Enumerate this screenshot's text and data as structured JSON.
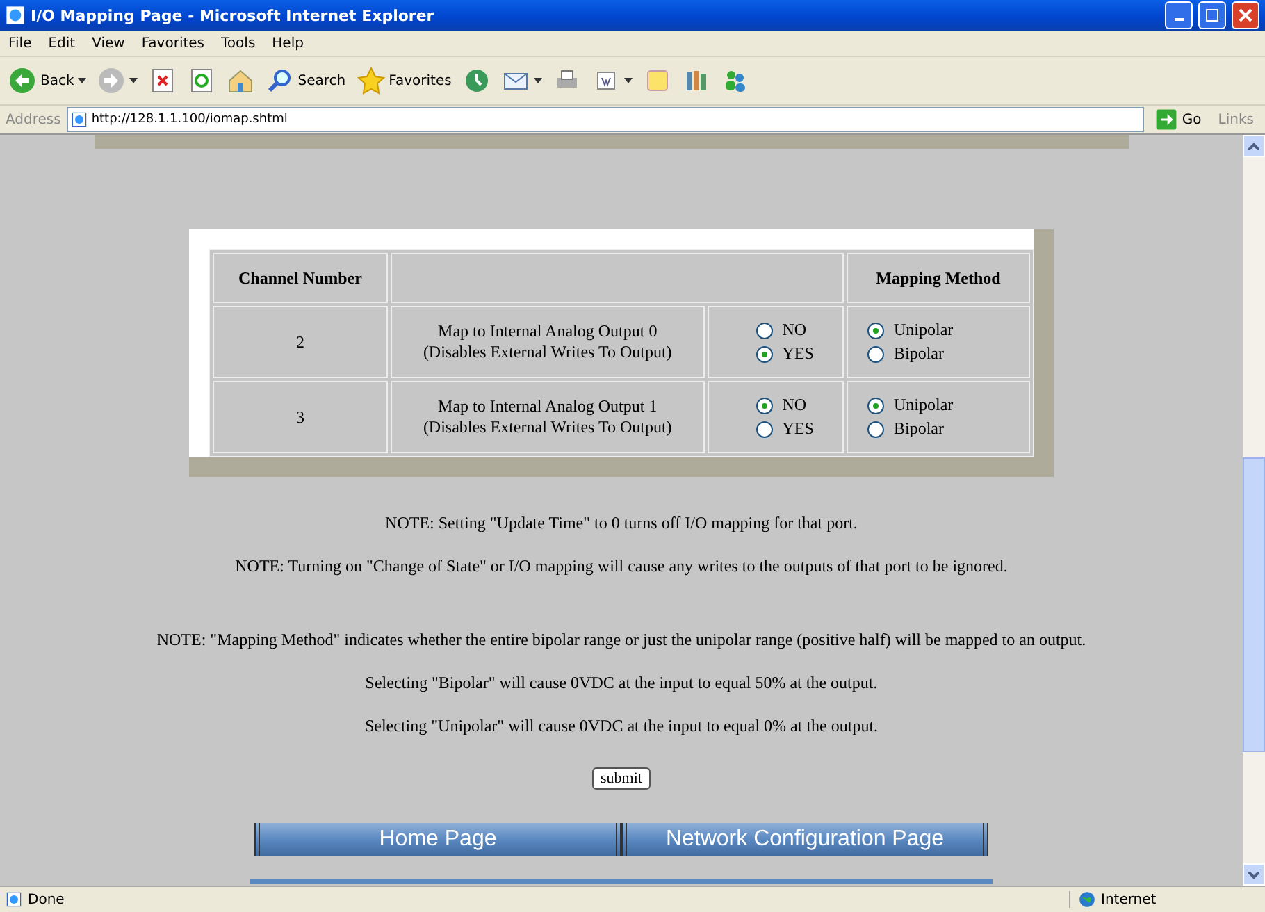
{
  "window": {
    "title": "I/O Mapping Page - Microsoft Internet Explorer"
  },
  "menu": [
    "File",
    "Edit",
    "View",
    "Favorites",
    "Tools",
    "Help"
  ],
  "toolbar": [
    {
      "kind": "back",
      "label": "Back"
    },
    {
      "kind": "forward"
    },
    {
      "kind": "stop"
    },
    {
      "kind": "refresh"
    },
    {
      "kind": "home"
    },
    {
      "kind": "search",
      "label": "Search"
    },
    {
      "kind": "favorites",
      "label": "Favorites"
    },
    {
      "kind": "history"
    },
    {
      "kind": "mail"
    },
    {
      "kind": "print"
    },
    {
      "kind": "edit"
    },
    {
      "kind": "folder"
    },
    {
      "kind": "research"
    },
    {
      "kind": "messenger"
    }
  ],
  "address": {
    "label": "Address",
    "url": "http://128.1.1.100/iomap.shtml",
    "go": "Go",
    "links": "Links"
  },
  "table": {
    "headers": [
      "Channel Number",
      "Mapping Method"
    ],
    "rows": [
      {
        "channel": "2",
        "description": [
          "Map to Internal Analog Output 0",
          "(Disables External Writes To Output)"
        ],
        "map": [
          {
            "label": "NO",
            "selected": false
          },
          {
            "label": "YES",
            "selected": true
          }
        ],
        "method": [
          {
            "label": "Unipolar",
            "selected": true
          },
          {
            "label": "Bipolar",
            "selected": false
          }
        ]
      },
      {
        "channel": "3",
        "description": [
          "Map to Internal Analog Output 1",
          "(Disables External Writes To Output)"
        ],
        "map": [
          {
            "label": "NO",
            "selected": true
          },
          {
            "label": "YES",
            "selected": false
          }
        ],
        "method": [
          {
            "label": "Unipolar",
            "selected": true
          },
          {
            "label": "Bipolar",
            "selected": false
          }
        ]
      }
    ]
  },
  "note_groups": [
    [
      "NOTE: Setting \"Update Time\" to 0 turns off I/O mapping for that port.",
      "NOTE: Turning on \"Change of State\" or I/O mapping will cause any writes to the outputs of that port to be ignored."
    ],
    [
      "NOTE: \"Mapping Method\" indicates whether the entire bipolar range or just the unipolar range (positive half) will be mapped to an output.",
      "Selecting \"Bipolar\" will cause 0VDC at the input to equal 50% at the output.",
      "Selecting \"Unipolar\" will cause 0VDC at the input to equal 0% at the output."
    ]
  ],
  "submit": "submit",
  "nav_links": [
    "Home Page",
    "Network Configuration Page"
  ],
  "status_bar": {
    "text": "Done",
    "zone": "Internet"
  }
}
